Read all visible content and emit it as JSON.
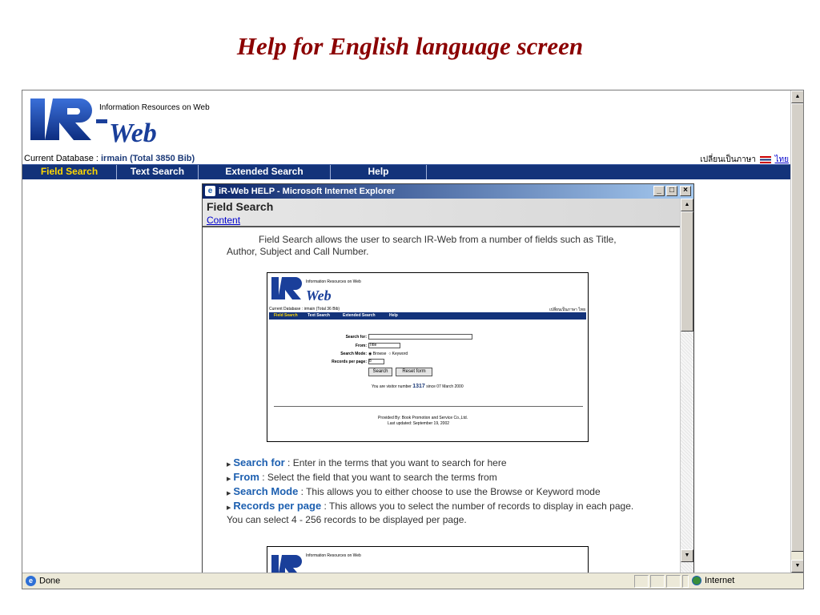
{
  "slide_title": "Help for English language screen",
  "browser": {
    "logo_tagline": "Information Resources on Web",
    "current_db_label": "Current Database : ",
    "current_db_value": "irmain (Total 3850 Bib)",
    "lang_switch_text": "เปลี่ยนเป็นภาษา",
    "lang_switch_link": "ไทย",
    "nav": [
      {
        "label": "Field Search",
        "active": true
      },
      {
        "label": "Text Search",
        "active": false
      },
      {
        "label": "Extended Search",
        "active": false
      },
      {
        "label": "Help",
        "active": false
      }
    ],
    "status": {
      "left": "Done",
      "zone": "Internet"
    }
  },
  "popup": {
    "window_title": "iR-Web HELP - Microsoft Internet Explorer",
    "header_title": "Field Search",
    "content_link": "Content",
    "intro": "Field Search allows the user to search IR-Web from a number of fields such as Title, Author, Subject and Call Number.",
    "items": [
      {
        "term": "Search for",
        "text": " : Enter in the terms that you want to search for here"
      },
      {
        "term": "From",
        "text": " : Select the field that you want to search the terms from"
      },
      {
        "term": "Search Mode",
        "text": " : This allows you to either choose to use the Browse or Keyword mode"
      },
      {
        "term": "Records per page",
        "text": " : This allows you to select the number of records to display in each page. You can select 4 - 256 records to be displayed per page."
      }
    ]
  },
  "mini": {
    "tagline": "Information Resources on Web",
    "db": "Current Database : irmain (Total 36 Bib)",
    "lang": "เปลี่ยนเป็นภาษา ไทย",
    "nav": [
      "Field Search",
      "Text Search",
      "Extended Search",
      "Help"
    ],
    "labels": {
      "search_for": "Search for:",
      "from": "From:",
      "search_mode": "Search Mode:",
      "records": "Records per page:"
    },
    "from_value": "Title",
    "mode_browse": "Browse",
    "mode_keyword": "Keyword",
    "records_value": "8",
    "search_btn": "Search",
    "reset_btn": "Reset form",
    "visitor_prefix": "You are visitor number",
    "visitor_number": "1317",
    "visitor_suffix": "since 07 March 2000",
    "provided_by": "Provided By: Book Promotion and Service Co.,Ltd.",
    "last_updated": "Last updated: September 19, 2002"
  },
  "colors": {
    "title": "#8b0000",
    "nav_bg": "#13337a",
    "nav_active": "#ffd700",
    "term": "#1c5fb0"
  },
  "icons": [
    "ie-page-icon",
    "flag-icon",
    "minimize-icon",
    "maximize-icon",
    "close-icon",
    "globe-icon",
    "scroll-up-icon",
    "scroll-down-icon",
    "bullet-icon"
  ]
}
